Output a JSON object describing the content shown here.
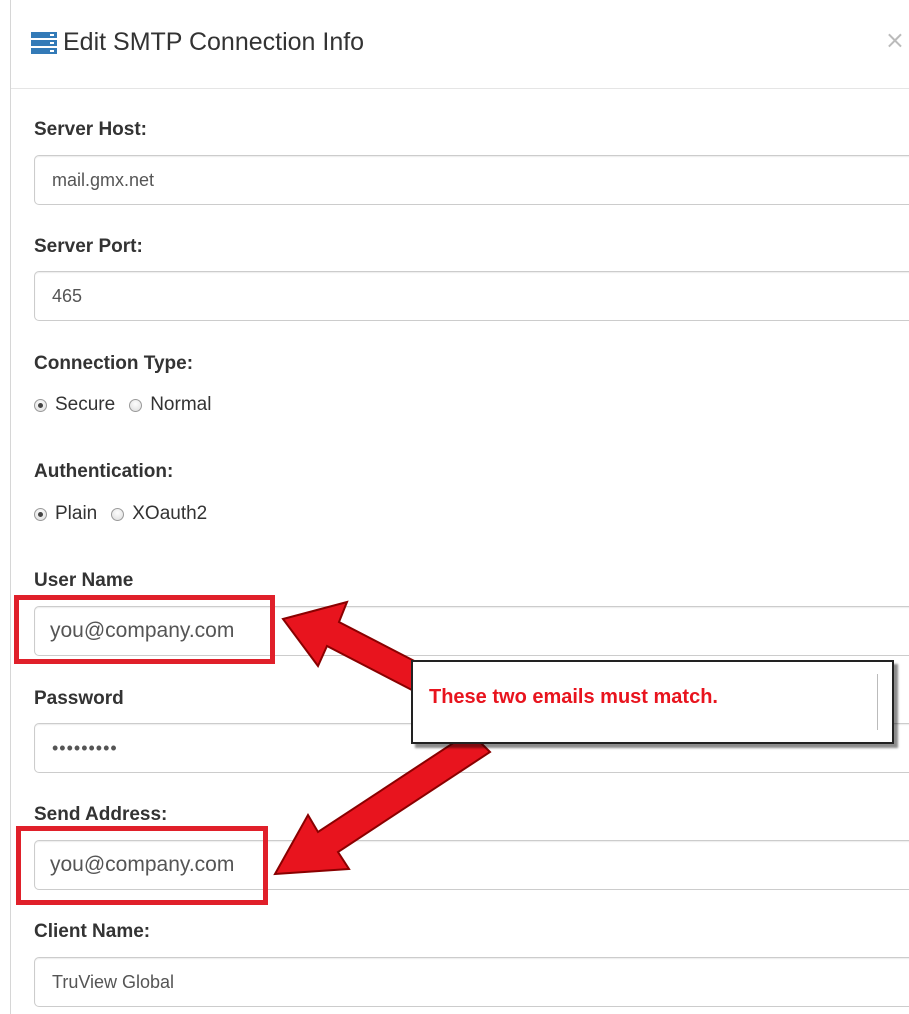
{
  "dialog": {
    "title": "Edit SMTP Connection Info",
    "close_glyph": "×",
    "title_icon": "server-list-icon"
  },
  "fields": {
    "server_host": {
      "label": "Server Host:",
      "value": "mail.gmx.net"
    },
    "server_port": {
      "label": "Server Port:",
      "value": "465"
    },
    "connection_type": {
      "label": "Connection Type:",
      "options": [
        "Secure",
        "Normal"
      ],
      "selected": "Secure"
    },
    "authentication": {
      "label": "Authentication:",
      "options": [
        "Plain",
        "XOauth2"
      ],
      "selected": "Plain"
    },
    "user_name": {
      "label": "User Name",
      "value": "you@company.com"
    },
    "password": {
      "label": "Password",
      "value": "•••••••••"
    },
    "send_address": {
      "label": "Send Address:",
      "value": "you@company.com"
    },
    "client_name": {
      "label": "Client Name:",
      "value": "TruView Global"
    }
  },
  "annotation": {
    "callout_text": "These two emails must match.",
    "highlight_color": "#e0202a",
    "arrow_color": "#e8141e"
  }
}
